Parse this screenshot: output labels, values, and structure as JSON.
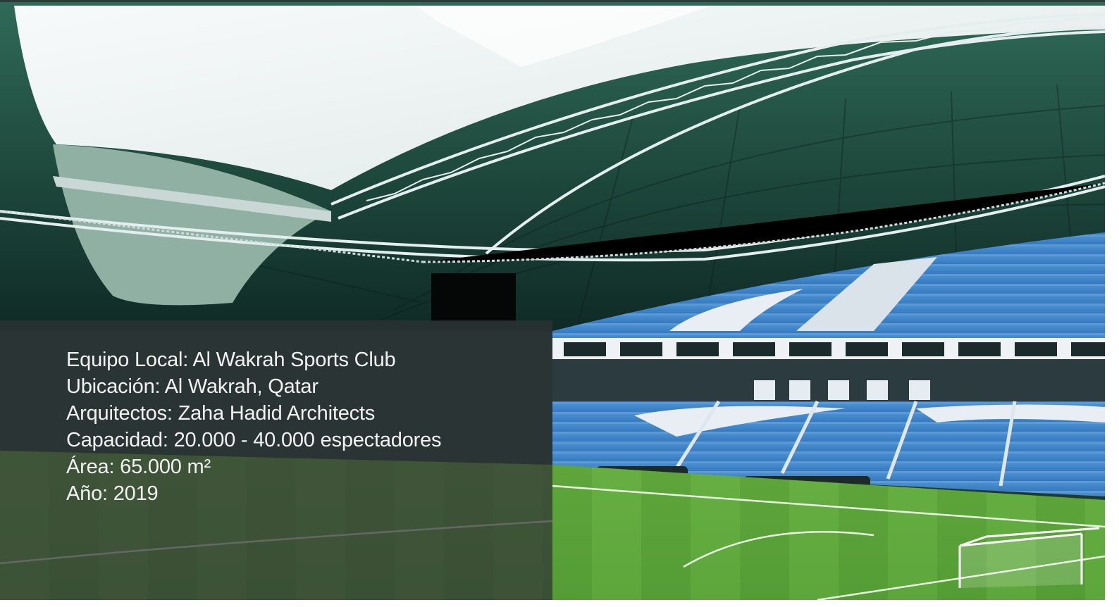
{
  "photo": {
    "subject": "stadium-interior-photo",
    "colors": {
      "roof_membrane": "#e9eff0",
      "roof_structure": "#2e5a4f",
      "truss": "#d9e6e6",
      "seats": "#3f86c8",
      "seats_dark": "#2f5fa8",
      "pitch": "#5fa83e",
      "pitch_light": "#86c25a"
    }
  },
  "overlay": {
    "background": "rgba(48,50,52,0.72)",
    "text_color": "#f2f2f2"
  },
  "info": {
    "team": "Equipo Local: Al Wakrah Sports Club",
    "location": "Ubicación: Al Wakrah, Qatar",
    "architects": "Arquitectos: Zaha Hadid Architects",
    "capacity": "Capacidad: 20.000 - 40.000 espectadores",
    "area": "Área:  65.000 m²",
    "year": "Año: 2019"
  }
}
